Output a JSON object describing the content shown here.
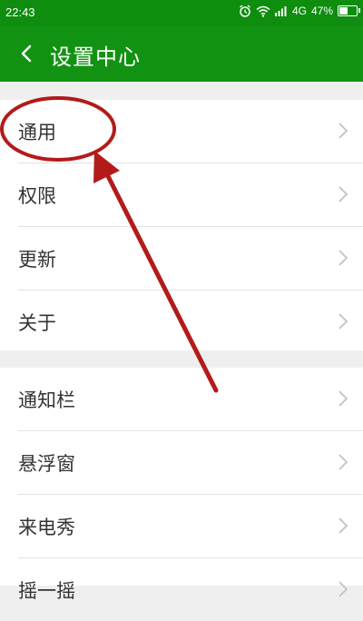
{
  "status_bar": {
    "time": "22:43",
    "network": "4G",
    "battery_percent": "47%",
    "battery_level": 0.47,
    "icons": [
      "alarm-icon",
      "wifi-icon",
      "signal-icon",
      "battery-icon"
    ]
  },
  "header": {
    "title": "设置中心",
    "back_icon": "chevron-left-icon"
  },
  "groups": [
    {
      "items": [
        "通用",
        "权限",
        "更新",
        "关于"
      ]
    },
    {
      "items": [
        "通知栏",
        "悬浮窗",
        "来电秀",
        "摇一摇"
      ]
    }
  ],
  "colors": {
    "status_bar": "#0f8d0f",
    "title_bar": "#129212",
    "annotation": "#b31b1b"
  }
}
